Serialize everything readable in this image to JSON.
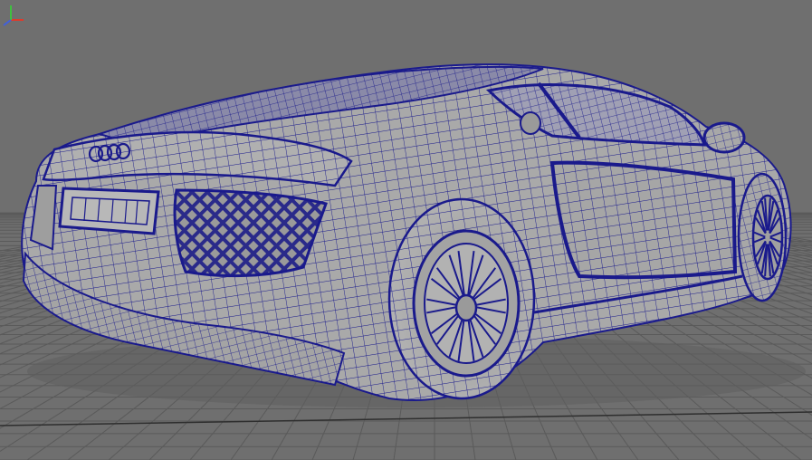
{
  "viewport": {
    "background_color": "#6f6f6f",
    "grid_color": "#5a5a5a",
    "grid_major_color": "#2e2e2e",
    "wireframe_color": "#1a1a8c",
    "surface_color": "#a8a8a8",
    "shadow_color": "#8f8f8f"
  },
  "model": {
    "brand_badge": "four-rings-logo",
    "parts": [
      "body",
      "rear-window",
      "side-window",
      "rear-grille",
      "license-plate",
      "side-mirror",
      "rear-wheel",
      "front-wheel",
      "side-blade"
    ]
  },
  "axis_gizmo": {
    "x_axis_color": "#e0392b",
    "y_axis_color": "#3fbf3f",
    "z_axis_color": "#3f5fe0"
  }
}
